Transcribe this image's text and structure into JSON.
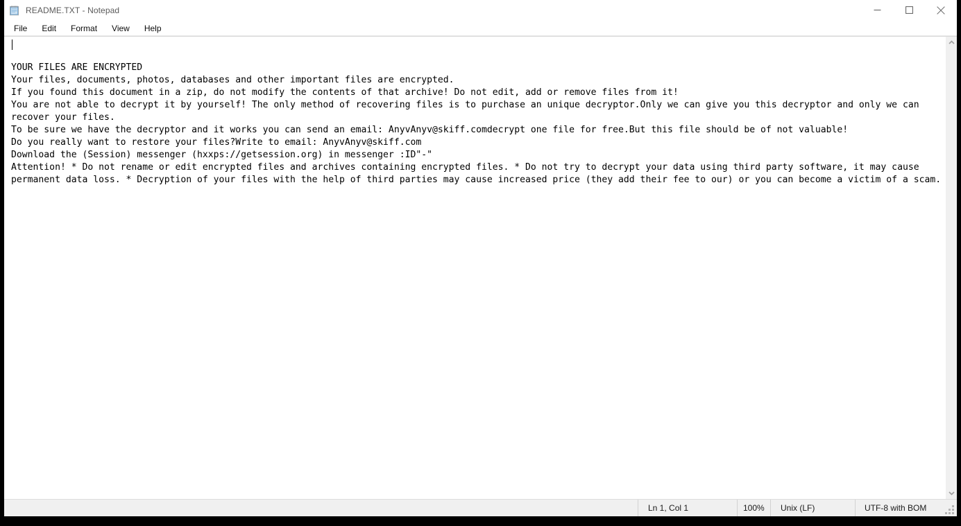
{
  "window": {
    "title": "README.TXT - Notepad",
    "icon": "notepad-icon",
    "controls": {
      "minimize_label": "Minimize",
      "maximize_label": "Maximize",
      "close_label": "Close"
    }
  },
  "menu": {
    "items": [
      {
        "label": "File"
      },
      {
        "label": "Edit"
      },
      {
        "label": "Format"
      },
      {
        "label": "View"
      },
      {
        "label": "Help"
      }
    ]
  },
  "editor": {
    "placeholder": "",
    "caret_position": "Ln 1, Col 1",
    "text": "\nYOUR FILES ARE ENCRYPTED\nYour files, documents, photos, databases and other important files are encrypted.\nIf you found this document in a zip, do not modify the contents of that archive! Do not edit, add or remove files from it!\nYou are not able to decrypt it by yourself! The only method of recovering files is to purchase an unique decryptor.Only we can give you this decryptor and only we can recover your files.\nTo be sure we have the decryptor and it works you can send an email: AnyvAnyv@skiff.comdecrypt one file for free.But this file should be of not valuable!\nDo you really want to restore your files?Write to email: AnyvAnyv@skiff.com\nDownload the (Session) messenger (hxxps://getsession.org) in messenger :ID\"-\"\nAttention! * Do not rename or edit encrypted files and archives containing encrypted files. * Do not try to decrypt your data using third party software, it may cause permanent data loss. * Decryption of your files with the help of third parties may cause increased price (they add their fee to our) or you can become a victim of a scam.",
    "lines": [
      "",
      "YOUR FILES ARE ENCRYPTED",
      "Your files, documents, photos, databases and other important files are encrypted.",
      "If you found this document in a zip, do not modify the contents of that archive! Do not edit, add or remove files from it!",
      "You are not able to decrypt it by yourself! The only method of recovering files is to purchase an unique decryptor.Only we can give you this decryptor and only we can recover your files.",
      "To be sure we have the decryptor and it works you can send an email: AnyvAnyv@skiff.comdecrypt one file for free.But this file should be of not valuable!",
      "Do you really want to restore your files?Write to email: AnyvAnyv@skiff.com",
      "Download the (Session) messenger (hxxps://getsession.org) in messenger :ID\"-\"",
      "Attention! * Do not rename or edit encrypted files and archives containing encrypted files. * Do not try to decrypt your data using third party software, it may cause permanent data loss. * Decryption of your files with the help of third parties may cause increased price (they add their fee to our) or you can become a victim of a scam."
    ],
    "contact_email": "AnyvAnyv@skiff.com",
    "messenger_url": "hxxps://getsession.org"
  },
  "scrollbar": {
    "up_arrow_label": "Scroll up",
    "down_arrow_label": "Scroll down"
  },
  "status_bar": {
    "cursor": "Ln 1, Col 1",
    "zoom": "100%",
    "line_ending": "Unix (LF)",
    "encoding": "UTF-8 with BOM"
  },
  "colors": {
    "window_bg": "#ffffff",
    "frame": "#000000",
    "status_bg": "#f0f0f0",
    "title_text": "#5a5a5a",
    "body_text": "#000000",
    "scrollbar_bg": "#f0f0f0",
    "separator": "#d2d2d2"
  }
}
